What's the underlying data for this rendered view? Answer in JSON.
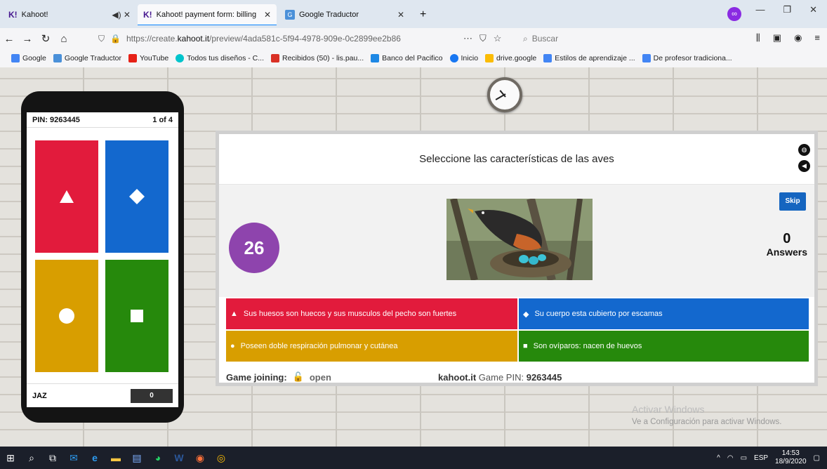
{
  "browser": {
    "tabs": [
      {
        "title": "Kahoot!",
        "icon": "kahoot-icon",
        "extra": "◀) ✕"
      },
      {
        "title": "Kahoot! payment form: billing",
        "icon": "kahoot-icon",
        "close": "✕"
      },
      {
        "title": "Google Traductor",
        "icon": "google-translate-icon",
        "close": "✕"
      }
    ],
    "new_tab": "+",
    "url_prefix": "https://create.",
    "url_host": "kahoot.it",
    "url_rest": "/preview/4ada581c-5f94-4978-909e-0c2899ee2b86",
    "search_placeholder": "Buscar",
    "bookmarks": [
      {
        "label": "Google",
        "color": "#4285f4"
      },
      {
        "label": "Google Traductor",
        "color": "#4a90d9"
      },
      {
        "label": "YouTube",
        "color": "#e62117"
      },
      {
        "label": "Todos tus diseños - C...",
        "color": "#00c4cc"
      },
      {
        "label": "Recibidos (50) - lis.pau...",
        "color": "#d93025"
      },
      {
        "label": "Banco del Pacifico",
        "color": "#1e88e5"
      },
      {
        "label": "Inicio",
        "color": "#1877f2"
      },
      {
        "label": "drive.google",
        "color": "#fbbc04"
      },
      {
        "label": "Estilos de aprendizaje ...",
        "color": "#4285f4"
      },
      {
        "label": "De profesor tradiciona...",
        "color": "#4285f4"
      }
    ]
  },
  "phone": {
    "pin": "PIN: 9263445",
    "progress": "1 of 4",
    "player": "JAZ",
    "score": "0",
    "tiles": [
      {
        "shape": "triangle-icon",
        "color": "#e21b3c"
      },
      {
        "shape": "diamond-icon",
        "color": "#1368ce"
      },
      {
        "shape": "circle-icon",
        "color": "#d89e00"
      },
      {
        "shape": "square-icon",
        "color": "#26890c"
      }
    ]
  },
  "game": {
    "question": "Seleccione las características de las aves",
    "timer": "26",
    "skip": "Skip",
    "answers_count": "0",
    "answers_label": "Answers",
    "options": [
      {
        "symbol": "▲",
        "text": "Sus huesos son huecos y sus musculos del pecho son fuertes",
        "color": "#e21b3c"
      },
      {
        "symbol": "◆",
        "text": "Su cuerpo esta cubierto por escamas",
        "color": "#1368ce"
      },
      {
        "symbol": "●",
        "text": "Poseen doble respiración pulmonar y cutánea",
        "color": "#d89e00"
      },
      {
        "symbol": "■",
        "text": "Son ovíparos: nacen de huevos",
        "color": "#26890c"
      }
    ],
    "footer_joining": "Game joining:",
    "footer_open": "open",
    "footer_site": "kahoot.it",
    "footer_pin_label": "Game PIN:",
    "footer_pin": "9263445"
  },
  "watermark": {
    "title": "Activar Windows",
    "subtitle": "Ve a Configuración para activar Windows."
  },
  "taskbar": {
    "lang": "ESP",
    "time": "14:53",
    "date": "18/9/2020"
  }
}
